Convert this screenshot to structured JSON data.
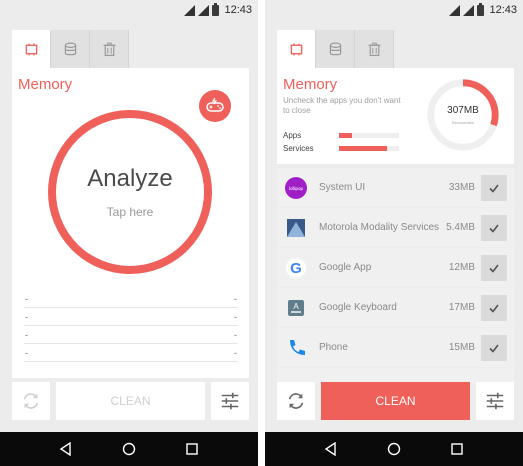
{
  "status_bar": {
    "time": "12:43"
  },
  "colors": {
    "accent": "#f0605a",
    "background": "#ececec"
  },
  "tabs": [
    {
      "icon": "chip-icon",
      "active": true
    },
    {
      "icon": "database-icon",
      "active": false
    },
    {
      "icon": "trash-icon",
      "active": false
    }
  ],
  "left_screen": {
    "title": "Memory",
    "analyze_label": "Analyze",
    "tap_label": "Tap here",
    "dash_rows": [
      {
        "left": "-",
        "right": "-"
      },
      {
        "left": "-",
        "right": "-"
      },
      {
        "left": "-",
        "right": "-"
      },
      {
        "left": "-",
        "right": "-"
      }
    ],
    "clean_label": "CLEAN"
  },
  "right_screen": {
    "title": "Memory",
    "subtitle": "Uncheck the apps you don't want to close",
    "usage": [
      {
        "label": "Apps",
        "fraction": 0.22
      },
      {
        "label": "Services",
        "fraction": 0.8
      }
    ],
    "donut_value": "307MB",
    "donut_sub": "Recoverable",
    "donut_fraction": 0.3,
    "apps": [
      {
        "name": "System UI",
        "size": "33MB",
        "icon": "lollipop-icon",
        "checked": true
      },
      {
        "name": "Motorola Modality Services",
        "size": "5.4MB",
        "icon": "motorola-icon",
        "checked": true
      },
      {
        "name": "Google App",
        "size": "12MB",
        "icon": "google-icon",
        "checked": true
      },
      {
        "name": "Google Keyboard",
        "size": "17MB",
        "icon": "keyboard-icon",
        "checked": true
      },
      {
        "name": "Phone",
        "size": "15MB",
        "icon": "phone-icon",
        "checked": true
      }
    ],
    "clean_label": "CLEAN"
  },
  "nav": {
    "back": "back-icon",
    "home": "home-icon",
    "recents": "recents-icon"
  }
}
